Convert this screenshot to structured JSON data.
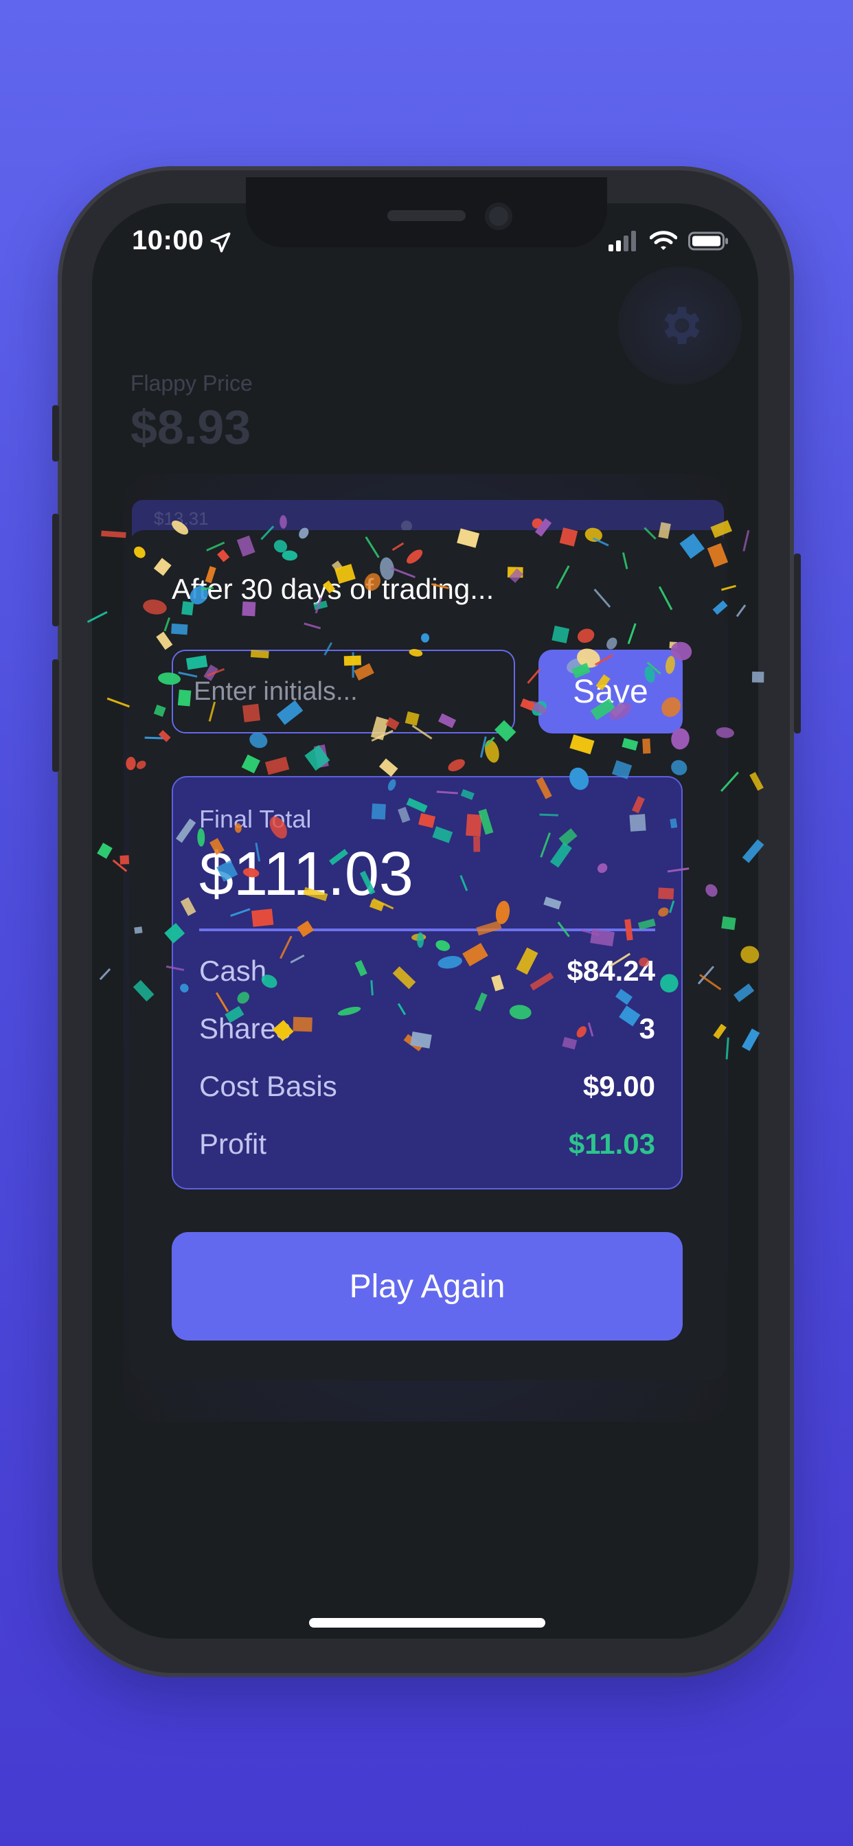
{
  "status_bar": {
    "time": "10:00"
  },
  "background_app": {
    "flappy_price_label": "Flappy Price",
    "flappy_price_value": "$8.93",
    "chart_peek_label": "$13.31"
  },
  "modal": {
    "title": "After 30 days of trading...",
    "initials": {
      "placeholder": "Enter initials...",
      "value": ""
    },
    "save_label": "Save",
    "summary": {
      "final_total_label": "Final Total",
      "final_total_value": "$111.03",
      "rows": [
        {
          "label": "Cash",
          "value": "$84.24"
        },
        {
          "label": "Shares",
          "value": "3"
        },
        {
          "label": "Cost Basis",
          "value": "$9.00"
        },
        {
          "label": "Profit",
          "value": "$11.03"
        }
      ]
    },
    "play_again_label": "Play Again"
  },
  "colors": {
    "accent": "#6369ee",
    "profit": "#2cc48d",
    "card": "#1d2024",
    "summary_bg": "#2e2c7c"
  },
  "icons": {
    "location": "location-arrow-icon",
    "signal": "cellular-signal-icon",
    "wifi": "wifi-icon",
    "battery": "battery-icon",
    "settings": "gear-icon"
  }
}
